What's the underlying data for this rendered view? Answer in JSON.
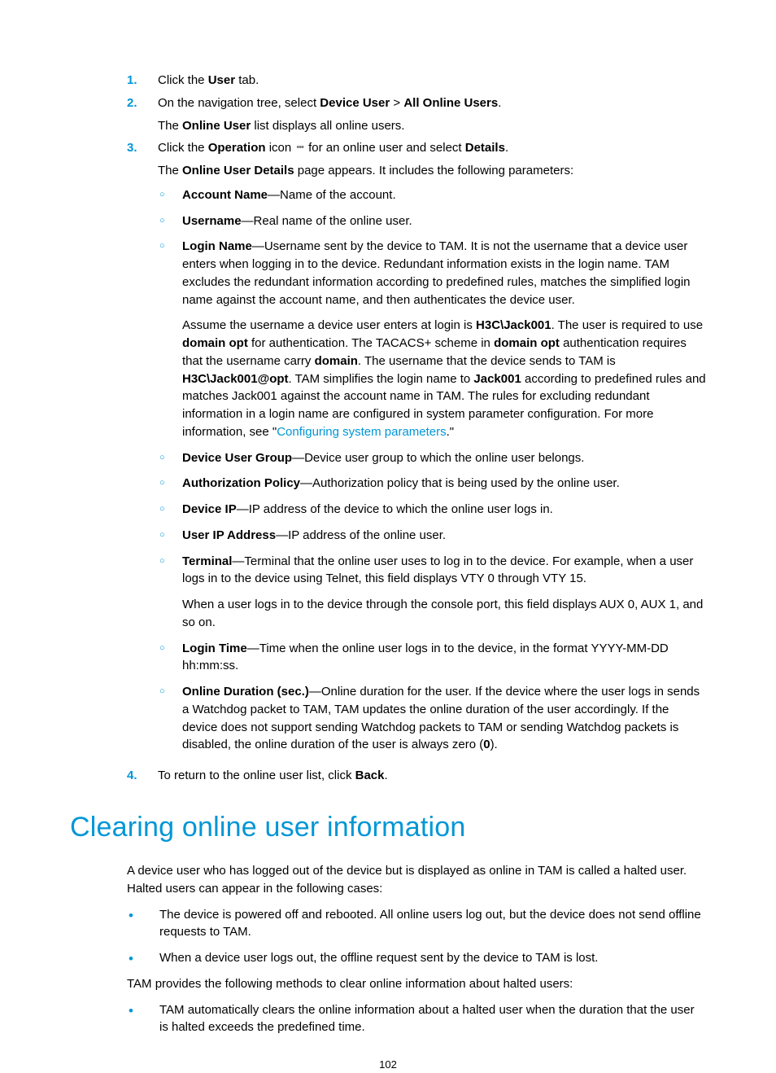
{
  "steps": {
    "s1": {
      "num": "1.",
      "text_a": "Click the ",
      "bold_a": "User",
      "text_b": " tab."
    },
    "s2": {
      "num": "2.",
      "text_a": "On the navigation tree, select ",
      "bold_a": "Device User",
      "gt": " > ",
      "bold_b": "All Online Users",
      "dot": ".",
      "p2_a": "The ",
      "p2_bold": "Online User",
      "p2_b": " list displays all online users."
    },
    "s3": {
      "num": "3.",
      "text_a": "Click the ",
      "bold_a": "Operation",
      "text_b": " icon ",
      "text_c": " for an online user and select ",
      "bold_b": "Details",
      "dot": ".",
      "p2_a": "The ",
      "p2_bold": "Online User Details",
      "p2_b": " page appears. It includes the following parameters:",
      "items": {
        "acct": {
          "bold": "Account Name",
          "text": "—Name of the account."
        },
        "uname": {
          "bold": "Username",
          "text": "—Real name of the online user."
        },
        "login": {
          "bold": "Login Name",
          "text": "—Username sent by the device to TAM. It is not the username that a device user enters when logging in to the device. Redundant information exists in the login name. TAM excludes the redundant information according to predefined rules, matches the simplified login name against the account name, and then authenticates the device user.",
          "p2_a": "Assume the username a device user enters at login is ",
          "p2_b1": "H3C\\Jack001",
          "p2_c": ". The user is required to use ",
          "p2_b2": "domain opt",
          "p2_d": " for authentication. The TACACS+ scheme in ",
          "p2_b3": "domain opt",
          "p2_e": " authentication requires that the username carry ",
          "p2_b4": "domain",
          "p2_f": ". The username that the device sends to TAM is ",
          "p2_b5": "H3C\\Jack001@opt",
          "p2_g": ". TAM simplifies the login name to ",
          "p2_b6": "Jack001",
          "p2_h": " according to predefined rules and matches Jack001 against the account name in TAM. The rules for excluding redundant information in a login name are configured in system parameter configuration. For more information, see \"",
          "p2_link": "Configuring system parameters",
          "p2_i": ".\""
        },
        "grp": {
          "bold": "Device User Group",
          "text": "—Device user group to which the online user belongs."
        },
        "auth": {
          "bold": "Authorization Policy",
          "text": "—Authorization policy that is being used by the online user."
        },
        "dip": {
          "bold": "Device IP",
          "text": "—IP address of the device to which the online user logs in."
        },
        "uip": {
          "bold": "User IP Address",
          "text": "—IP address of the online user."
        },
        "term": {
          "bold": "Terminal",
          "text": "—Terminal that the online user uses to log in to the device. For example, when a user logs in to the device using Telnet, this field displays VTY 0 through VTY 15.",
          "p2": "When a user logs in to the device through the console port, this field displays AUX 0, AUX 1, and so on."
        },
        "ltime": {
          "bold": "Login Time",
          "text": "—Time when the online user logs in to the device, in the format YYYY-MM-DD hh:mm:ss."
        },
        "odur": {
          "bold": "Online Duration (sec.)",
          "text_a": "—Online duration for the user. If the device where the user logs in sends a Watchdog packet to TAM, TAM updates the online duration of the user accordingly. If the device does not support sending Watchdog packets to TAM or sending Watchdog packets is disabled, the online duration of the user is always zero (",
          "bold_zero": "0",
          "text_b": ")."
        }
      }
    },
    "s4": {
      "num": "4.",
      "text_a": "To return to the online user list, click ",
      "bold_a": "Back",
      "dot": "."
    }
  },
  "heading": "Clearing online user information",
  "clr_intro": "A device user who has logged out of the device but is displayed as online in TAM is called a halted user. Halted users can appear in the following cases:",
  "clr_b1": "The device is powered off and rebooted. All online users log out, but the device does not send offline requests to TAM.",
  "clr_b2": "When a device user logs out, the offline request sent by the device to TAM is lost.",
  "clr_mid": "TAM provides the following methods to clear online information about halted users:",
  "clr_b3": "TAM automatically clears the online information about a halted user when the duration that the user is halted exceeds the predefined time.",
  "page_num": "102",
  "ellipsis": "•••"
}
